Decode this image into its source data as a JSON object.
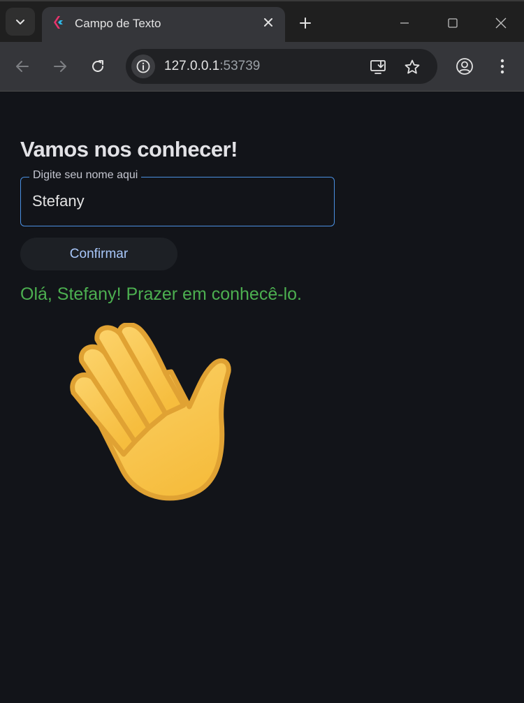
{
  "browser": {
    "tab_title": "Campo de Texto",
    "url_host": "127.0.0.1",
    "url_port": ":53739"
  },
  "page": {
    "heading": "Vamos nos conhecer!",
    "name_field": {
      "label": "Digite seu nome aqui",
      "value": "Stefany"
    },
    "confirm_label": "Confirmar",
    "greeting": "Olá, Stefany! Prazer em conhecê-lo."
  },
  "colors": {
    "page_background": "#121419",
    "field_border": "#4a90e2",
    "button_text": "#a8c7fa",
    "greeting_text": "#4caf50",
    "hand": "#fcc95b"
  },
  "icons": {
    "tab_search": "chevron-down-icon",
    "favicon": "flutter-icon",
    "tab_close": "close-icon",
    "new_tab": "plus-icon",
    "back": "arrow-left-icon",
    "forward": "arrow-right-icon",
    "reload": "reload-icon",
    "site_info": "info-icon",
    "install": "install-app-icon",
    "bookmark": "star-icon",
    "profile": "profile-icon",
    "menu": "kebab-menu-icon",
    "illustration": "waving-hand-icon"
  }
}
